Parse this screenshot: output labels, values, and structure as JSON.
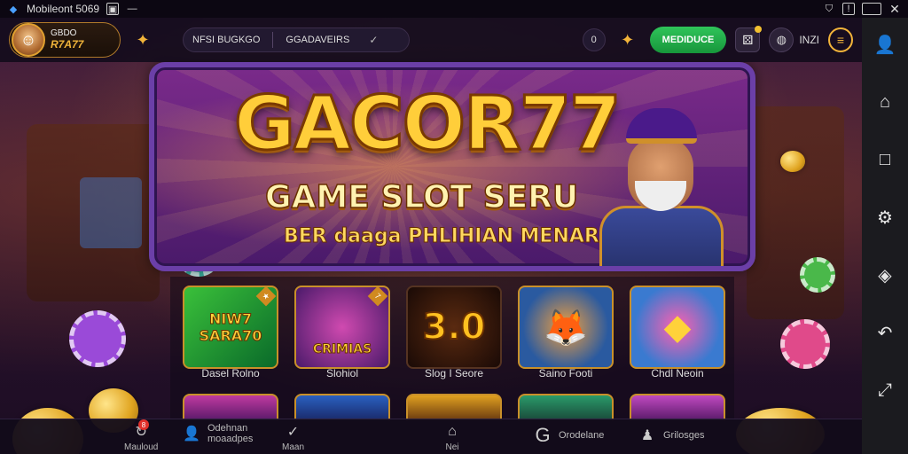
{
  "statusbar": {
    "title": "Mobileont 5069",
    "icons": [
      "shield-icon",
      "warning-icon",
      "battery-icon",
      "close-icon"
    ]
  },
  "header": {
    "profile_name": "GBDO",
    "profile_brand": "R7A77",
    "pill_left": "NFSI BUGKGO",
    "pill_right": "GGADAVEIRS",
    "circle_btn": "0",
    "green_button": "MEDIDUCE",
    "lang_label": "INZI"
  },
  "banner": {
    "title": "GACOR77",
    "subtitle": "GAME SLOT SERU",
    "tagline": "BER daaga PHLIHIAN MENARIK"
  },
  "games": [
    {
      "art": "NIW7 SARA70",
      "label": "Dasel Rolno",
      "color": "#2a8a2a"
    },
    {
      "art": "CRIMIAS",
      "label": "Slohiol",
      "color": "#7a2a7a"
    },
    {
      "art": "3.0",
      "label": "Slog I Seore",
      "color": "#3a1a10"
    },
    {
      "art": "FOX",
      "label": "Saino Footi",
      "color": "#2a5aa0"
    },
    {
      "art": "GEM",
      "label": "Chdl Neoin",
      "color": "#3a7ad0"
    }
  ],
  "bottom_nav": [
    {
      "label": "Mauloud",
      "icon": "refresh-icon",
      "badge": "8"
    },
    {
      "label": "Odehnan moaadpes",
      "icon": "user-icon"
    },
    {
      "label": "Maan",
      "icon": "check-icon"
    },
    {
      "label": "Nei",
      "icon": "home-icon"
    },
    {
      "label": "Orodelane",
      "icon": "g-icon"
    },
    {
      "label": "Grilosges",
      "icon": "person-icon"
    }
  ],
  "sidebar_icons": [
    "user-icon",
    "home-icon",
    "square-icon",
    "settings-icon",
    "rotate-icon",
    "back-icon",
    "expand-icon"
  ]
}
